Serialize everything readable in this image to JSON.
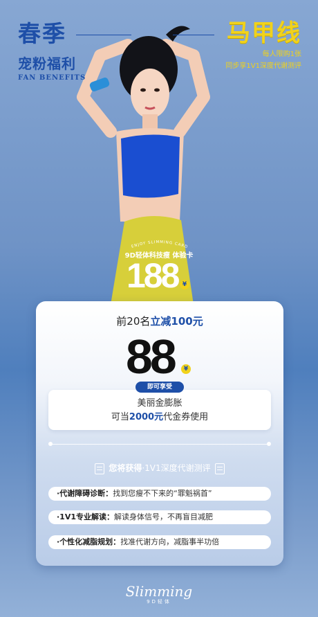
{
  "header": {
    "left_title": "春季",
    "left_subtitle": "宠粉福利",
    "left_en": "FAN BENEFITS",
    "right_title": "马甲线",
    "right_line1": "每人限购1张",
    "right_line2": "同步享1V1深度代谢测评"
  },
  "card_badge": {
    "enjoy_text": "ENJOY SLIMMING CARD",
    "trial_label": "9D轻体科技瘦 体验卡",
    "original_price": "188",
    "currency": "¥"
  },
  "offer": {
    "promo_prefix": "前20名",
    "promo_highlight": "立减100元",
    "price": "88",
    "currency": "¥",
    "pill": "即可享受",
    "voucher_line1": "美丽金膨胀",
    "voucher_line2_prefix": "可当",
    "voucher_line2_amount": "2000元",
    "voucher_line2_suffix": "代金券使用"
  },
  "gain": {
    "bold": "您将获得",
    "rest": "·1V1深度代谢测评"
  },
  "benefits": [
    {
      "title": "·代谢障碍诊断：",
      "text": "找到您瘦不下来的“罪魁祸首”"
    },
    {
      "title": "·1V1专业解读：",
      "text": "解读身体信号，不再盲目减肥"
    },
    {
      "title": "·个性化减脂规划：",
      "text": "找准代谢方向，减脂事半功倍"
    }
  ],
  "logo": {
    "script": "Slimming",
    "tag": "9D轻体"
  },
  "colors": {
    "brand_blue": "#1e4fa8",
    "accent_yellow": "#f1d21b"
  }
}
